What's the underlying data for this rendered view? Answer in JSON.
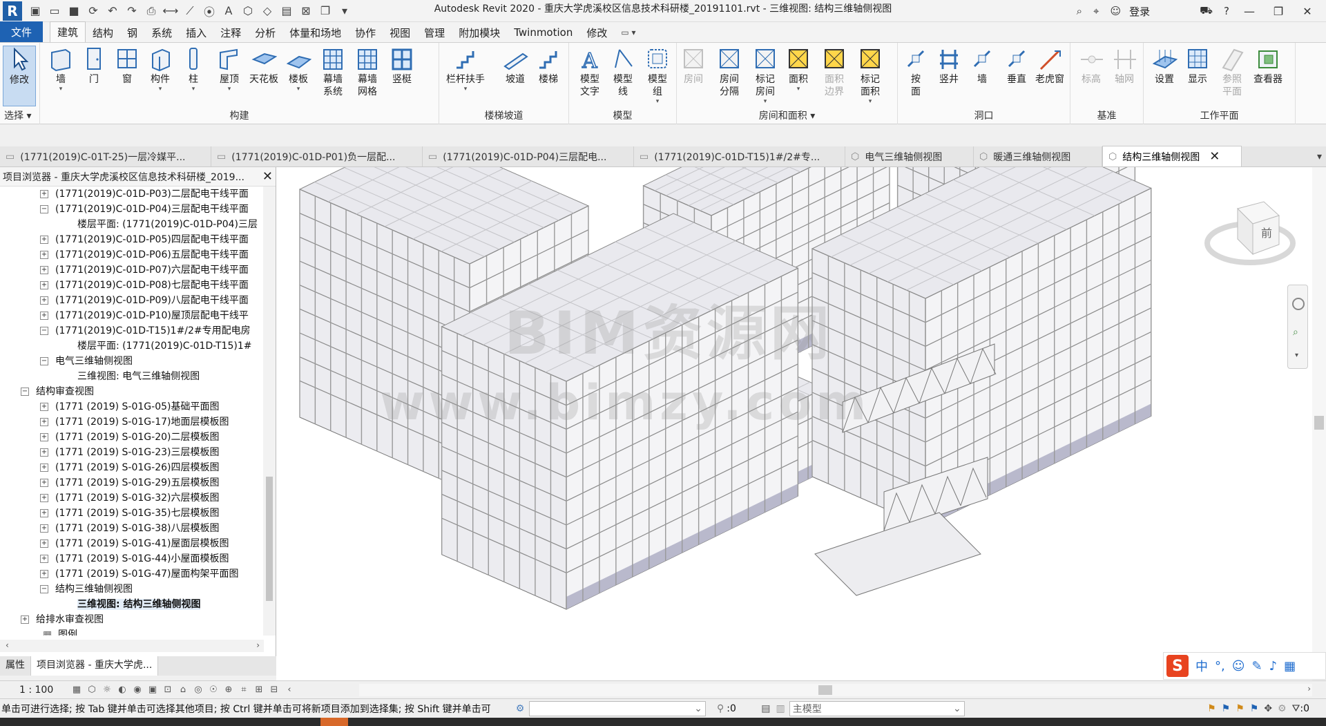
{
  "app": {
    "title": "Autodesk Revit 2020 - 重庆大学虎溪校区信息技术科研楼_20191101.rvt - 三维视图: 结构三维轴侧视图",
    "login": "登录"
  },
  "ribbon_tabs": [
    "文件",
    "建筑",
    "结构",
    "钢",
    "系统",
    "插入",
    "注释",
    "分析",
    "体量和场地",
    "协作",
    "视图",
    "管理",
    "附加模块",
    "Twinmotion",
    "修改"
  ],
  "active_tab": "建筑",
  "ribbon": {
    "select": {
      "label": "修改",
      "group": "选择"
    },
    "build": {
      "group": "构建",
      "buttons": [
        "墙",
        "门",
        "窗",
        "构件",
        "柱",
        "屋顶",
        "天花板",
        "楼板",
        "幕墙\n系统",
        "幕墙\n网格",
        "竖梃"
      ]
    },
    "stairs": {
      "group": "楼梯坡道",
      "buttons": [
        "栏杆扶手",
        "坡道",
        "楼梯"
      ]
    },
    "model": {
      "group": "模型",
      "buttons": [
        "模型\n文字",
        "模型\n线",
        "模型\n组"
      ]
    },
    "room": {
      "group": "房间和面积",
      "buttons": [
        "房间",
        "房间\n分隔",
        "标记\n房间",
        "面积",
        "面积\n边界",
        "标记\n面积"
      ]
    },
    "opening": {
      "group": "洞口",
      "buttons": [
        "按\n面",
        "竖井",
        "墙",
        "垂直",
        "老虎窗"
      ]
    },
    "datum": {
      "group": "基准",
      "buttons": [
        "标高",
        "轴网"
      ]
    },
    "workplane": {
      "group": "工作平面",
      "buttons": [
        "设置",
        "显示",
        "参照\n平面",
        "查看器"
      ]
    }
  },
  "doc_tabs": [
    "(1771(2019)C-01T-25)一层冷媒平...",
    "(1771(2019)C-01D-P01)负一层配...",
    "(1771(2019)C-01D-P04)三层配电...",
    "(1771(2019)C-01D-T15)1#/2#专...",
    "电气三维轴侧视图",
    "暖通三维轴侧视图",
    "结构三维轴侧视图"
  ],
  "browser": {
    "title": "项目浏览器 - 重庆大学虎溪校区信息技术科研楼_2019...",
    "rows": [
      {
        "level": 2,
        "tog": "+",
        "label": "(1771(2019)C-01D-P03)二层配电干线平面"
      },
      {
        "level": 2,
        "tog": "−",
        "label": "(1771(2019)C-01D-P04)三层配电干线平面"
      },
      {
        "level": 3,
        "tog": "",
        "label": "楼层平面: (1771(2019)C-01D-P04)三层"
      },
      {
        "level": 2,
        "tog": "+",
        "label": "(1771(2019)C-01D-P05)四层配电干线平面"
      },
      {
        "level": 2,
        "tog": "+",
        "label": "(1771(2019)C-01D-P06)五层配电干线平面"
      },
      {
        "level": 2,
        "tog": "+",
        "label": "(1771(2019)C-01D-P07)六层配电干线平面"
      },
      {
        "level": 2,
        "tog": "+",
        "label": "(1771(2019)C-01D-P08)七层配电干线平面"
      },
      {
        "level": 2,
        "tog": "+",
        "label": "(1771(2019)C-01D-P09)八层配电干线平面"
      },
      {
        "level": 2,
        "tog": "+",
        "label": "(1771(2019)C-01D-P10)屋顶层配电干线平"
      },
      {
        "level": 2,
        "tog": "−",
        "label": "(1771(2019)C-01D-T15)1#/2#专用配电房"
      },
      {
        "level": 3,
        "tog": "",
        "label": "楼层平面: (1771(2019)C-01D-T15)1#"
      },
      {
        "level": 2,
        "tog": "−",
        "label": "电气三维轴侧视图"
      },
      {
        "level": 3,
        "tog": "",
        "label": "三维视图: 电气三维轴侧视图"
      },
      {
        "level": 1,
        "tog": "−",
        "label": "结构审查视图"
      },
      {
        "level": 2,
        "tog": "+",
        "label": "(1771 (2019) S-01G-05)基础平面图"
      },
      {
        "level": 2,
        "tog": "+",
        "label": "(1771 (2019) S-01G-17)地面层模板图"
      },
      {
        "level": 2,
        "tog": "+",
        "label": "(1771 (2019) S-01G-20)二层模板图"
      },
      {
        "level": 2,
        "tog": "+",
        "label": "(1771 (2019) S-01G-23)三层模板图"
      },
      {
        "level": 2,
        "tog": "+",
        "label": "(1771 (2019) S-01G-26)四层模板图"
      },
      {
        "level": 2,
        "tog": "+",
        "label": "(1771 (2019) S-01G-29)五层模板图"
      },
      {
        "level": 2,
        "tog": "+",
        "label": "(1771 (2019) S-01G-32)六层模板图"
      },
      {
        "level": 2,
        "tog": "+",
        "label": "(1771 (2019) S-01G-35)七层模板图"
      },
      {
        "level": 2,
        "tog": "+",
        "label": "(1771 (2019) S-01G-38)八层模板图"
      },
      {
        "level": 2,
        "tog": "+",
        "label": "(1771 (2019) S-01G-41)屋面层模板图"
      },
      {
        "level": 2,
        "tog": "+",
        "label": "(1771 (2019) S-01G-44)小屋面模板图"
      },
      {
        "level": 2,
        "tog": "+",
        "label": "(1771 (2019) S-01G-47)屋面构架平面图"
      },
      {
        "level": 2,
        "tog": "−",
        "label": "结构三维轴侧视图"
      },
      {
        "level": 3,
        "tog": "",
        "label": "三维视图: 结构三维轴侧视图",
        "selected": true
      },
      {
        "level": 1,
        "tog": "+",
        "label": "给排水审查视图"
      },
      {
        "level": 1,
        "tog": "",
        "label": "图例"
      }
    ],
    "panel_tabs": [
      "属性",
      "项目浏览器 - 重庆大学虎..."
    ]
  },
  "viewcube": {
    "face": "前"
  },
  "watermark": {
    "line1": "BIM资源网",
    "line2": "www.bimzy.com"
  },
  "view_control": {
    "scale": "1 : 100"
  },
  "status": {
    "message": "单击可进行选择; 按 Tab 键并单击可选择其他项目; 按 Ctrl 键并单击可将新项目添加到选择集; 按 Shift 键并单击可",
    "count": ":0",
    "model": "主模型",
    "filter": ":0"
  },
  "ime": {
    "zh": "中"
  },
  "colors": {
    "file_tab": "#1e62b3",
    "accent": "#7aa7d9"
  }
}
